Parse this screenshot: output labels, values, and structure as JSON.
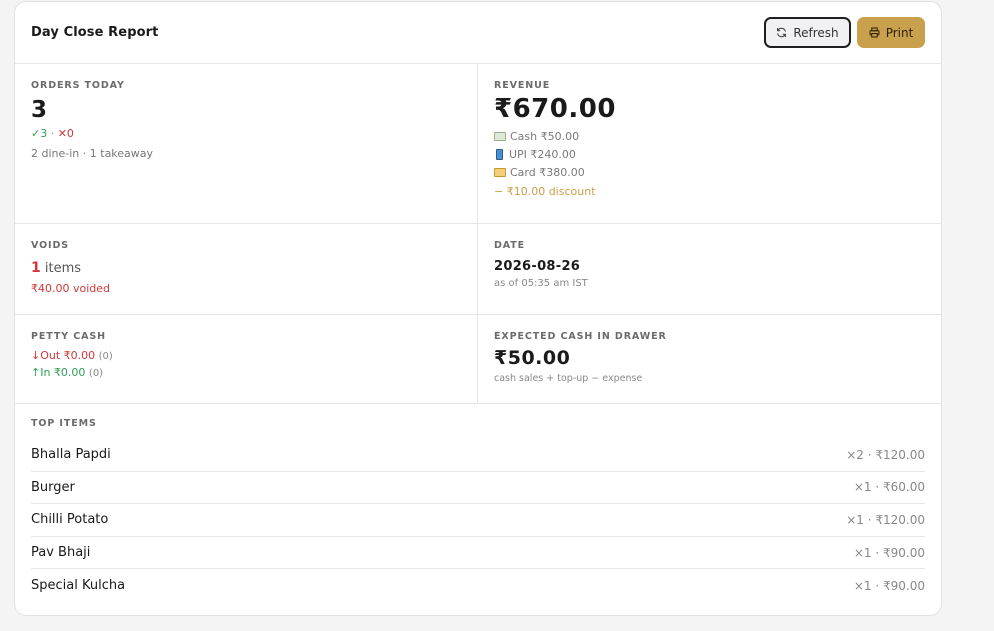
{
  "header": {
    "title": "Day Close Report",
    "refresh_label": "Refresh",
    "print_label": "Print"
  },
  "orders": {
    "label": "ORDERS TODAY",
    "count": "3",
    "completed": "✓3",
    "sep": " · ",
    "cancelled": "✕0",
    "breakdown": "2 dine-in · 1 takeaway"
  },
  "revenue": {
    "label": "REVENUE",
    "total": "₹670.00",
    "cash": "Cash ₹50.00",
    "upi": "UPI ₹240.00",
    "card": "Card ₹380.00",
    "discount": "− ₹10.00 discount"
  },
  "voids": {
    "label": "VOIDS",
    "count": "1",
    "unit": "items",
    "amount": "₹40.00 voided"
  },
  "date": {
    "label": "DATE",
    "value": "2026-08-26",
    "as_of": "as of 05:35 am IST"
  },
  "petty_cash": {
    "label": "PETTY CASH",
    "out_text": "↓Out ₹0.00",
    "out_count": "(0)",
    "in_text": "↑In ₹0.00",
    "in_count": "(0)"
  },
  "expected_cash": {
    "label": "EXPECTED CASH IN DRAWER",
    "value": "₹50.00",
    "formula": "cash sales + top-up − expense"
  },
  "top_items": {
    "label": "TOP ITEMS",
    "items": [
      {
        "name": "Bhalla Papdi",
        "meta": "×2 · ₹120.00"
      },
      {
        "name": "Burger",
        "meta": "×1 · ₹60.00"
      },
      {
        "name": "Chilli Potato",
        "meta": "×1 · ₹120.00"
      },
      {
        "name": "Pav Bhaji",
        "meta": "×1 · ₹90.00"
      },
      {
        "name": "Special Kulcha",
        "meta": "×1 · ₹90.00"
      }
    ]
  },
  "colors": {
    "accent": "#c9a04c",
    "success": "#2f9e57",
    "danger": "#d2373a"
  },
  "icons": [
    "refresh-icon",
    "printer-icon",
    "cash-icon",
    "upi-phone-icon",
    "card-icon"
  ]
}
